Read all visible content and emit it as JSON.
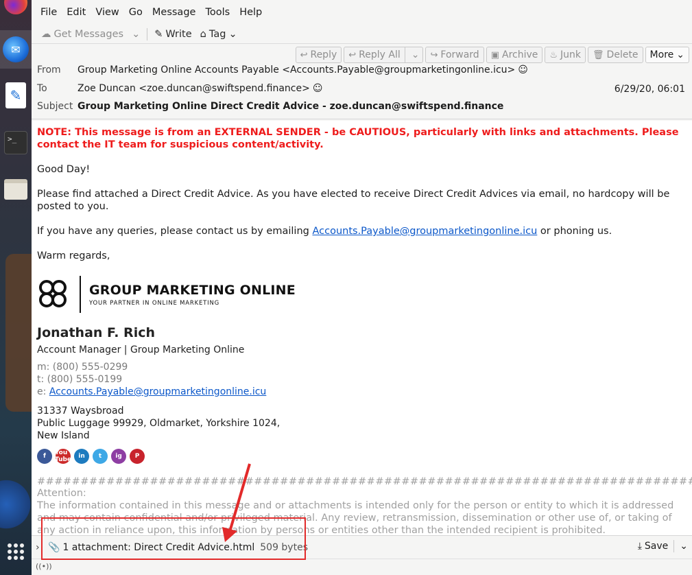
{
  "menubar": [
    "File",
    "Edit",
    "View",
    "Go",
    "Message",
    "Tools",
    "Help"
  ],
  "toolbar": {
    "get_messages": "Get Messages",
    "write": "Write",
    "tag": "Tag"
  },
  "actions": {
    "reply": "Reply",
    "reply_all": "Reply All",
    "forward": "Forward",
    "archive": "Archive",
    "junk": "Junk",
    "delete": "Delete",
    "more": "More"
  },
  "header": {
    "from_label": "From",
    "from_value": "Group Marketing Online Accounts Payable <Accounts.Payable@groupmarketingonline.icu>",
    "to_label": "To",
    "to_value": "Zoe Duncan <zoe.duncan@swiftspend.finance>",
    "subject_label": "Subject",
    "subject_value": "Group Marketing Online Direct Credit Advice - zoe.duncan@swiftspend.finance",
    "date": "6/29/20, 06:01"
  },
  "body": {
    "warning": "NOTE: This message is from an EXTERNAL SENDER - be CAUTIOUS, particularly with links and attachments. Please contact the IT team for suspicious content/activity.",
    "greeting": "Good Day!",
    "para1": "Please find attached a Direct Credit Advice. As you have elected to receive Direct Credit Advices via email, no hardcopy will be posted to you.",
    "para2_pre": "If you have any queries, please contact us by emailing ",
    "para2_link": "Accounts.Payable@groupmarketingonline.icu",
    "para2_post": " or phoning us.",
    "closing": "Warm regards,",
    "logo_name": "GROUP MARKETING ONLINE",
    "logo_tag": "YOUR PARTNER IN ONLINE MARKETING",
    "sig_name": "Jonathan F. Rich",
    "sig_title": "Account Manager | Group Marketing Online",
    "phone_m": "m: (800) 555-0299",
    "phone_t": "t: (800) 555-0199",
    "email_label": "e: ",
    "email_link": "Accounts.Payable@groupmarketingonline.icu",
    "address1": "31337 Waysbroad",
    "address2": "Public Luggage 99929, Oldmarket, Yorkshire 1024,",
    "address3": "New Island",
    "hashes": "################################################################################################",
    "attention": "Attention:",
    "disclaimer": "The information contained in this message and or attachments is intended only for the person or entity to which it is addressed and may contain confidential and/or privileged material. Any review, retransmission, dissemination or other use of, or taking of any action in reliance upon, this information by persons or entities other than the intended recipient is prohibited."
  },
  "social": [
    {
      "icon": "facebook-icon",
      "label": "f",
      "color": "#3b5998"
    },
    {
      "icon": "youtube-icon",
      "label": "You Tube",
      "color": "#cc2b2b"
    },
    {
      "icon": "linkedin-icon",
      "label": "in",
      "color": "#1d7bbf"
    },
    {
      "icon": "twitter-icon",
      "label": "t",
      "color": "#3ea8e6"
    },
    {
      "icon": "instagram-icon",
      "label": "ig",
      "color": "#8e3ea3"
    },
    {
      "icon": "pinterest-icon",
      "label": "P",
      "color": "#c8232c"
    }
  ],
  "attachment": {
    "label": "1 attachment: Direct Credit Advice.html",
    "size": "509 bytes",
    "save": "Save"
  },
  "colors": {
    "warning": "#ee1c1c",
    "link": "#0b57c9",
    "annotation": "#e22a2a"
  }
}
